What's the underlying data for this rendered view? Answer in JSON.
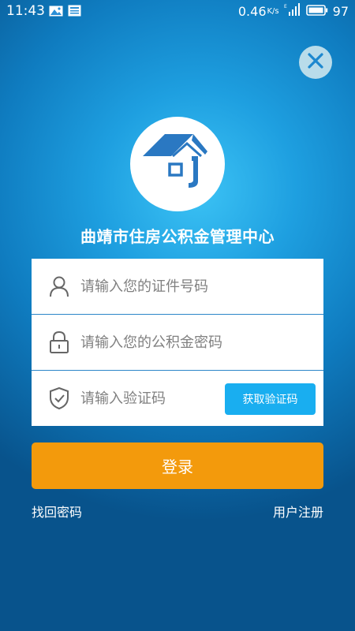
{
  "status_bar": {
    "time": "11:43",
    "speed": "0.46",
    "speed_unit": "K/s",
    "battery": "97",
    "icons": [
      "gallery-icon",
      "news-icon",
      "signal-icon",
      "battery-icon"
    ]
  },
  "header": {
    "close_icon": "close-icon",
    "logo_icon": "house-logo-icon",
    "title": "曲靖市住房公积金管理中心"
  },
  "form": {
    "id_placeholder": "请输入您的证件号码",
    "password_placeholder": "请输入您的公积金密码",
    "code_placeholder": "请输入验证码",
    "get_code_label": "获取验证码",
    "login_label": "登录"
  },
  "links": {
    "forgot_password": "找回密码",
    "register": "用户注册"
  },
  "colors": {
    "accent": "#19aef0",
    "login": "#f39a0c",
    "logo_blue": "#2a78c2"
  }
}
